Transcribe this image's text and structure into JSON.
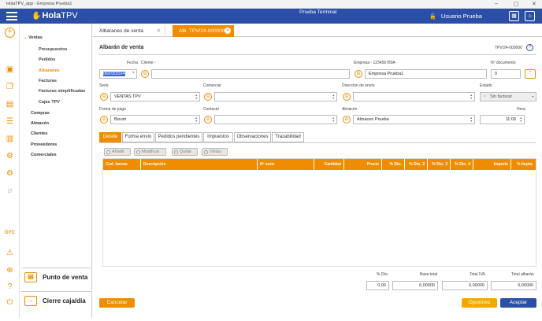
{
  "window": {
    "title": "HolaTPV_app - Empresa Prueba1"
  },
  "header": {
    "brand_a": "Hola",
    "brand_b": "TPV",
    "terminal": "Prueba Terminal",
    "user": "Usuario Prueba"
  },
  "rail": {
    "label": "GYC"
  },
  "menu": {
    "ventas": "Ventas",
    "items": [
      "Presupuestos",
      "Pedidos",
      "Albaranes",
      "Facturas",
      "Facturas simplificadas",
      "Cajas TPV"
    ],
    "top": [
      "Compras",
      "Almacén",
      "Clientes",
      "Proveedores",
      "Comerciales"
    ],
    "pos": "Punto de venta",
    "cierre": "Cierre caja/día"
  },
  "tabs": {
    "list": "Albaranes de venta",
    "doc": "Alb. TPV/24-000000"
  },
  "form": {
    "title": "Albarán de venta",
    "doc_code": "TPV/24-000000",
    "fecha_label": "Fecha",
    "fecha": "06/03/2024",
    "cliente_label": "Cliente -",
    "cliente": "",
    "empresa_label": "Empresa - 123456789A",
    "empresa": "Empresa Prueba1",
    "ndoc_label": "Nº documento",
    "ndoc": "0",
    "serie_label": "Serie",
    "serie": "VENTAS TPV",
    "comercial_label": "Comercial",
    "comercial": "",
    "direccion_label": "Dirección de envío",
    "direccion": "",
    "estado_label": "Estado",
    "estado": "Sin facturar",
    "pago_label": "Forma de pago",
    "pago": "Bizum",
    "contacto_label": "Contacto",
    "contacto": "",
    "almacen_label": "Almacén",
    "almacen": "Almacen Prueba",
    "hora_label": "Hora",
    "hora": "11:03"
  },
  "subtabs": [
    "Detalle",
    "Forma envío",
    "Pedidos pendientes",
    "Impuestos",
    "Observaciones",
    "Trazabilidad"
  ],
  "toolbar": {
    "add": "Añadir",
    "modify": "Modificar",
    "remove": "Quitar",
    "views": "Vistas"
  },
  "grid": {
    "columns": [
      "Cod. barras",
      "Descripción",
      "Nº serie",
      "Cantidad",
      "Precio",
      "% Dto.",
      "% Dto. 2",
      "% Dto. 3",
      "% Dto. 4",
      "Importe",
      "% Impto."
    ]
  },
  "totals": {
    "dto_label": "% Dto.",
    "dto": "0,00",
    "base_label": "Base total",
    "base": "0,00000",
    "iva_label": "Total IVA",
    "iva": "0,00000",
    "total_label": "Total albarán",
    "total": "0,00000"
  },
  "footer": {
    "cancel": "Cancelar",
    "options": "Opciones",
    "accept": "Aceptar"
  },
  "colors": {
    "primary": "#2b4ea6",
    "accent": "#f08c00",
    "accept": "#2b4ea6"
  }
}
